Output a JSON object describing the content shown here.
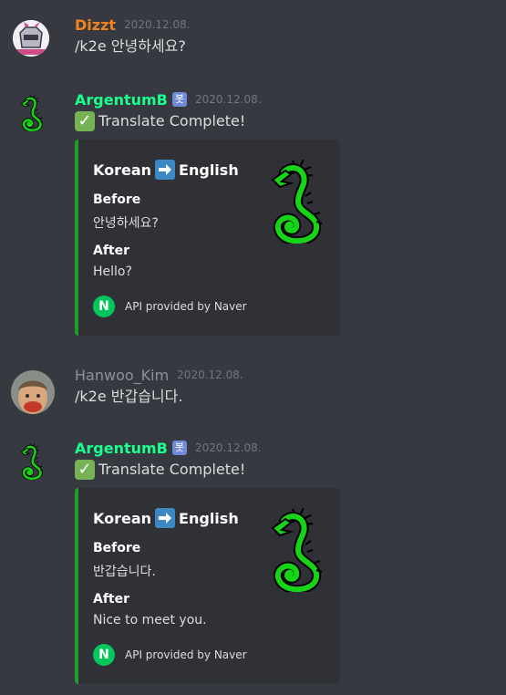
{
  "colors": {
    "background": "#36393f",
    "embed_background": "#2f3136",
    "embed_border": "#1f9e28",
    "dizzt_name": "#f0831e",
    "bot_name": "#1bff8f",
    "hanwoo_name": "#8e9297",
    "timestamp": "#72767d",
    "bot_tag": "#7289da",
    "naver_green": "#03c75a"
  },
  "messages": [
    {
      "username": "Dizzt",
      "timestamp": "2020.12.08.",
      "text": "/k2e 안녕하세요?",
      "avatar_icon": "knight-avatar-icon"
    },
    {
      "username": "ArgentumB",
      "bot_tag": "봇",
      "timestamp": "2020.12.08.",
      "text": "Translate Complete!",
      "check_icon": "check-mark-icon",
      "avatar_icon": "green-dragon-avatar-icon",
      "embed": {
        "title_from": "Korean",
        "title_to": "English",
        "arrow_icon": "right-arrow-icon",
        "before_label": "Before",
        "before_value": "안녕하세요?",
        "after_label": "After",
        "after_value": "Hello?",
        "footer_icon": "N",
        "footer_text": "API provided by Naver",
        "thumbnail_icon": "green-dragon-thumbnail-icon"
      }
    },
    {
      "username": "Hanwoo_Kim",
      "timestamp": "2020.12.08.",
      "text": "/k2e 반갑습니다.",
      "avatar_icon": "character-avatar-icon"
    },
    {
      "username": "ArgentumB",
      "bot_tag": "봇",
      "timestamp": "2020.12.08.",
      "text": "Translate Complete!",
      "check_icon": "check-mark-icon",
      "avatar_icon": "green-dragon-avatar-icon",
      "embed": {
        "title_from": "Korean",
        "title_to": "English",
        "arrow_icon": "right-arrow-icon",
        "before_label": "Before",
        "before_value": "반갑습니다.",
        "after_label": "After",
        "after_value": "Nice to meet you.",
        "footer_icon": "N",
        "footer_text": "API provided by Naver",
        "thumbnail_icon": "green-dragon-thumbnail-icon"
      }
    }
  ]
}
